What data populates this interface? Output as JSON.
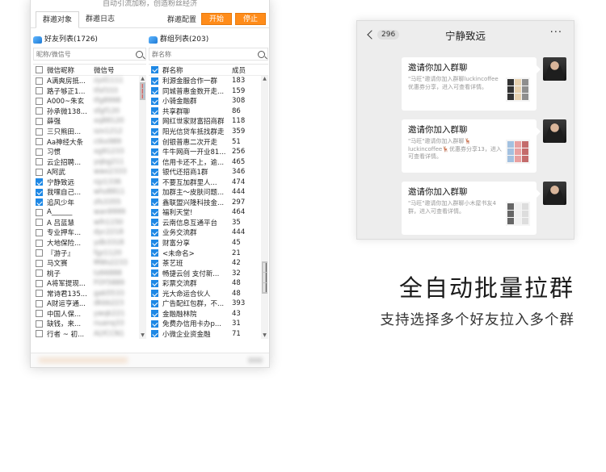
{
  "app": {
    "top_note": "自动引流加粉，创造粉丝经济",
    "tabs": [
      {
        "label": "群邀对象",
        "active": true
      },
      {
        "label": "群邀日志",
        "active": false
      }
    ],
    "config_label": "群邀配置",
    "start_button": "开始",
    "stop_button": "停止",
    "accent_color": "#ff8c1a",
    "checkbox_color": "#1e88e5"
  },
  "friends": {
    "title": "好友列表(1726)",
    "search_placeholder": "昵称/微信号",
    "col_nickname": "微信昵称",
    "col_wechat_id": "微信号",
    "rows": [
      {
        "name": "A满爽房抵...",
        "wx": "zyd1111",
        "checked": false
      },
      {
        "name": "路子够正1...",
        "wx": "tfsf333",
        "checked": false
      },
      {
        "name": "A000~朱玄",
        "wx": "tfg8998",
        "checked": false
      },
      {
        "name": "孙承微138...",
        "wx": "sfgf120",
        "checked": false
      },
      {
        "name": "薛强",
        "wx": "xq88120",
        "checked": false
      },
      {
        "name": "三只熊田...",
        "wx": "szx1212",
        "checked": false
      },
      {
        "name": "Aa神经大条",
        "wx": "ctkx989",
        "checked": false
      },
      {
        "name": "习惯",
        "wx": "xg91233",
        "checked": false
      },
      {
        "name": "云企招聘...",
        "wx": "yqbg211",
        "checked": false
      },
      {
        "name": "A阿武",
        "wx": "wwx2333",
        "checked": false
      },
      {
        "name": "宁静致远",
        "wx": "njz1336",
        "checked": true
      },
      {
        "name": "我嘿自己...",
        "wx": "whz8811",
        "checked": true
      },
      {
        "name": "追风少年",
        "wx": "zfs3355",
        "checked": true
      },
      {
        "name": "A______",
        "wx": "wan9999",
        "checked": false
      },
      {
        "name": "A 吕蓝慧",
        "wx": "wlh1150",
        "checked": false
      },
      {
        "name": "专业押车...",
        "wx": "dyc2218",
        "checked": false
      },
      {
        "name": "大地保险...",
        "wx": "ydb3318",
        "checked": false
      },
      {
        "name": "『游子』",
        "wx": "fgz1120",
        "checked": false
      },
      {
        "name": "马文赛",
        "wx": "MWs2233",
        "checked": false
      },
      {
        "name": "桃子",
        "wx": "tz66888",
        "checked": false
      },
      {
        "name": "A将军提现...",
        "wx": "FOY5889",
        "checked": false
      },
      {
        "name": "常诗君135...",
        "wx": "gab5533",
        "checked": false
      },
      {
        "name": "A财运亨通...",
        "wx": "dkbb223",
        "checked": false
      },
      {
        "name": "中国人保...",
        "wx": "ywqk221",
        "checked": false
      },
      {
        "name": "缺钱，来...",
        "wx": "nuanq33",
        "checked": false
      },
      {
        "name": "行者 ~ 初...",
        "wx": "ALYCCN1",
        "checked": false
      }
    ]
  },
  "groups": {
    "title": "群组列表(203)",
    "search_placeholder": "群名称",
    "col_group": "群名称",
    "col_members": "成员",
    "rows": [
      {
        "name": "利源金服合作一群",
        "members": "183",
        "checked": true
      },
      {
        "name": "同城普惠金数开走...",
        "members": "159",
        "checked": true
      },
      {
        "name": "小骑金融群",
        "members": "308",
        "checked": true
      },
      {
        "name": "共享群聊",
        "members": "86",
        "checked": true
      },
      {
        "name": "网红世家财富招商群",
        "members": "118",
        "checked": true
      },
      {
        "name": "阳光信贷车抵找群走",
        "members": "359",
        "checked": true
      },
      {
        "name": "创银普惠二次开走",
        "members": "51",
        "checked": true
      },
      {
        "name": "牛牛网商一开业81...",
        "members": "256",
        "checked": true
      },
      {
        "name": "信用卡还不上，逾...",
        "members": "465",
        "checked": true
      },
      {
        "name": "银代还招商1群",
        "members": "346",
        "checked": true
      },
      {
        "name": "不要互加群里人...",
        "members": "474",
        "checked": true
      },
      {
        "name": "加群主～皮肤问题...",
        "members": "444",
        "checked": true
      },
      {
        "name": "鑫联盟兴隆科技金...",
        "members": "297",
        "checked": true
      },
      {
        "name": "福利天堂!",
        "members": "464",
        "checked": true
      },
      {
        "name": "云南信息互通平台",
        "members": "35",
        "checked": true
      },
      {
        "name": "业务交流群",
        "members": "444",
        "checked": true
      },
      {
        "name": "财富分享",
        "members": "45",
        "checked": true
      },
      {
        "name": "<未命名>",
        "members": "21",
        "checked": true
      },
      {
        "name": "茶艺班",
        "members": "42",
        "checked": true
      },
      {
        "name": "畅捷云创 支付新...",
        "members": "32",
        "checked": true
      },
      {
        "name": "彩票交流群",
        "members": "48",
        "checked": true
      },
      {
        "name": "光大命运合伙人",
        "members": "48",
        "checked": true
      },
      {
        "name": "广告配红包群，不...",
        "members": "393",
        "checked": true
      },
      {
        "name": "金融融林院",
        "members": "43",
        "checked": true
      },
      {
        "name": "免费办信用卡办p...",
        "members": "31",
        "checked": true
      },
      {
        "name": "小微企业资金融",
        "members": "71",
        "checked": true
      }
    ]
  },
  "chat": {
    "back_count": "296",
    "title": "宁静致远",
    "more_icon": "more-dots-icon",
    "messages": [
      {
        "title": "邀请你加入群聊",
        "body": "\"马旺\"邀请你加入群聊luckincoffee优惠券分享，进入可查看详情。"
      },
      {
        "title": "邀请你加入群聊",
        "body": "\"马旺\"邀请你加入群聊🦌luckincoffee🦌优惠券分享13，进入可查看详情。"
      },
      {
        "title": "邀请你加入群聊",
        "body": "\"马旺\"邀请你加入群聊小木屋书友4群，进入可查看详情。"
      }
    ]
  },
  "marketing": {
    "headline": "全自动批量拉群",
    "subline": "支持选择多个好友拉入多个群"
  }
}
